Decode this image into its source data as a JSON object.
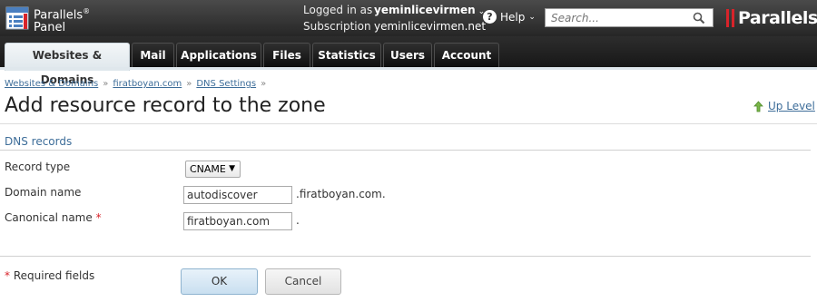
{
  "header": {
    "logo_line1": "Parallels",
    "logo_line2": "Panel",
    "logo_reg": "®",
    "logged_in_label": "Logged in as",
    "logged_in_user": "yeminlicevirmen",
    "subscription_label": "Subscription",
    "subscription_value": "yeminlicevirmen.net",
    "help_label": "Help",
    "search_placeholder": "Search...",
    "brand": "Parallels"
  },
  "tabs": [
    {
      "label": "Websites & Domains",
      "active": true
    },
    {
      "label": "Mail",
      "active": false
    },
    {
      "label": "Applications",
      "active": false
    },
    {
      "label": "Files",
      "active": false
    },
    {
      "label": "Statistics",
      "active": false
    },
    {
      "label": "Users",
      "active": false
    },
    {
      "label": "Account",
      "active": false
    }
  ],
  "breadcrumb": [
    "Websites & Domains",
    "firatboyan.com",
    "DNS Settings"
  ],
  "breadcrumb_sep": "»",
  "page": {
    "title": "Add resource record to the zone",
    "up_level": "Up Level",
    "section": "DNS records"
  },
  "form": {
    "record_type_label": "Record type",
    "record_type_value": "CNAME",
    "domain_name_label": "Domain name",
    "domain_name_value": "autodiscover",
    "domain_suffix": ".firatboyan.com.",
    "canonical_label": "Canonical name",
    "canonical_value": "firatboyan.com",
    "canonical_suffix": ".",
    "required_star": "*",
    "required_note": "Required fields"
  },
  "buttons": {
    "ok": "OK",
    "cancel": "Cancel"
  },
  "colors": {
    "link": "#3d6d99",
    "required": "#d8232a",
    "brand_red": "#d8232a"
  }
}
